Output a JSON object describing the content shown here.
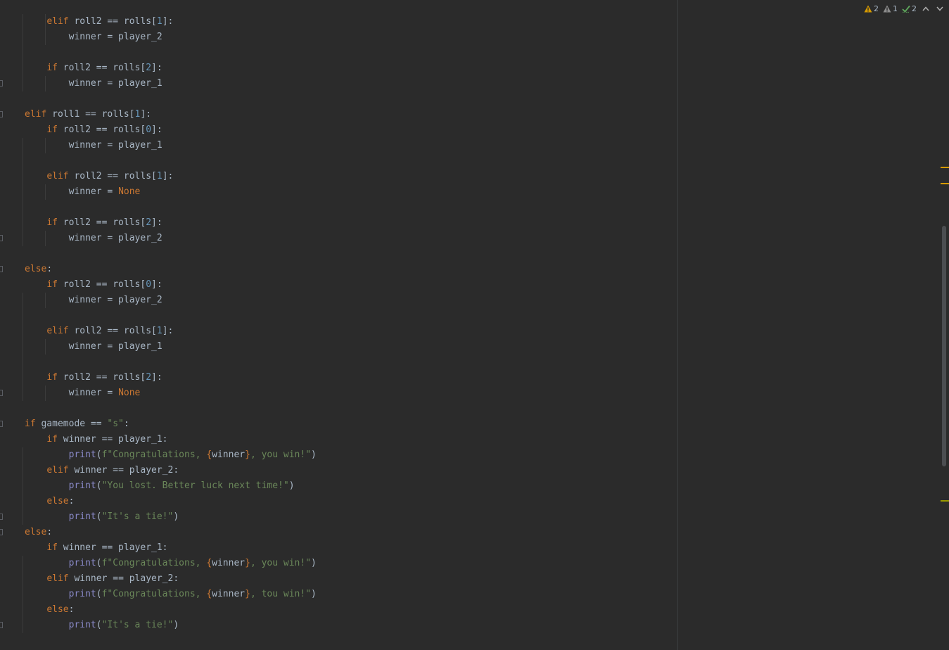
{
  "inspections": {
    "warning_yellow_count": "2",
    "warning_gray_count": "1",
    "typo_count": "2"
  },
  "colors": {
    "background": "#2b2b2b",
    "keyword": "#cc7832",
    "number": "#6897bb",
    "string": "#6a8759",
    "builtin": "#8888c6",
    "identifier": "#a9b7c6",
    "warning_stripe": "#d69a00",
    "weak_stripe": "#999900"
  },
  "code_lines": [
    [
      {
        "t": "    "
      },
      {
        "t": "elif",
        "c": "kw"
      },
      {
        "t": " roll2 == rolls["
      },
      {
        "t": "1",
        "c": "num"
      },
      {
        "t": "]:"
      }
    ],
    [
      {
        "t": "        winner = player_2"
      }
    ],
    [],
    [
      {
        "t": "    "
      },
      {
        "t": "if",
        "c": "kw"
      },
      {
        "t": " roll2 == rolls["
      },
      {
        "t": "2",
        "c": "num"
      },
      {
        "t": "]:"
      }
    ],
    [
      {
        "t": "        winner = player_1"
      }
    ],
    [],
    [
      {
        "t": "elif",
        "c": "kw"
      },
      {
        "t": " roll1 == rolls["
      },
      {
        "t": "1",
        "c": "num"
      },
      {
        "t": "]:"
      }
    ],
    [
      {
        "t": "    "
      },
      {
        "t": "if",
        "c": "kw"
      },
      {
        "t": " roll2 == rolls["
      },
      {
        "t": "0",
        "c": "num"
      },
      {
        "t": "]:"
      }
    ],
    [
      {
        "t": "        winner = player_1"
      }
    ],
    [],
    [
      {
        "t": "    "
      },
      {
        "t": "elif",
        "c": "kw"
      },
      {
        "t": " roll2 == rolls["
      },
      {
        "t": "1",
        "c": "num"
      },
      {
        "t": "]:"
      }
    ],
    [
      {
        "t": "        winner = "
      },
      {
        "t": "None",
        "c": "kw"
      }
    ],
    [],
    [
      {
        "t": "    "
      },
      {
        "t": "if",
        "c": "kw"
      },
      {
        "t": " roll2 == rolls["
      },
      {
        "t": "2",
        "c": "num"
      },
      {
        "t": "]:"
      }
    ],
    [
      {
        "t": "        winner = player_2"
      }
    ],
    [],
    [
      {
        "t": "else",
        "c": "kw"
      },
      {
        "t": ":"
      }
    ],
    [
      {
        "t": "    "
      },
      {
        "t": "if",
        "c": "kw"
      },
      {
        "t": " roll2 == rolls["
      },
      {
        "t": "0",
        "c": "num"
      },
      {
        "t": "]:"
      }
    ],
    [
      {
        "t": "        winner = player_2"
      }
    ],
    [],
    [
      {
        "t": "    "
      },
      {
        "t": "elif",
        "c": "kw"
      },
      {
        "t": " roll2 == rolls["
      },
      {
        "t": "1",
        "c": "num"
      },
      {
        "t": "]:"
      }
    ],
    [
      {
        "t": "        winner = player_1"
      }
    ],
    [],
    [
      {
        "t": "    "
      },
      {
        "t": "if",
        "c": "kw"
      },
      {
        "t": " roll2 == rolls["
      },
      {
        "t": "2",
        "c": "num"
      },
      {
        "t": "]:"
      }
    ],
    [
      {
        "t": "        winner = "
      },
      {
        "t": "None",
        "c": "kw"
      }
    ],
    [],
    [
      {
        "t": "if",
        "c": "kw"
      },
      {
        "t": " gamemode == "
      },
      {
        "t": "\"s\"",
        "c": "str"
      },
      {
        "t": ":"
      }
    ],
    [
      {
        "t": "    "
      },
      {
        "t": "if",
        "c": "kw"
      },
      {
        "t": " winner == player_1:"
      }
    ],
    [
      {
        "t": "        "
      },
      {
        "t": "print",
        "c": "fn"
      },
      {
        "t": "("
      },
      {
        "t": "f\"Congratulations, ",
        "c": "str"
      },
      {
        "t": "{",
        "c": "br"
      },
      {
        "t": "winner"
      },
      {
        "t": "}",
        "c": "br"
      },
      {
        "t": ", you win!\"",
        "c": "str"
      },
      {
        "t": ")"
      }
    ],
    [
      {
        "t": "    "
      },
      {
        "t": "elif",
        "c": "kw"
      },
      {
        "t": " winner == player_2:"
      }
    ],
    [
      {
        "t": "        "
      },
      {
        "t": "print",
        "c": "fn"
      },
      {
        "t": "("
      },
      {
        "t": "\"You lost. Better luck next time!\"",
        "c": "str"
      },
      {
        "t": ")"
      }
    ],
    [
      {
        "t": "    "
      },
      {
        "t": "else",
        "c": "kw"
      },
      {
        "t": ":"
      }
    ],
    [
      {
        "t": "        "
      },
      {
        "t": "print",
        "c": "fn"
      },
      {
        "t": "("
      },
      {
        "t": "\"It's a tie!\"",
        "c": "str"
      },
      {
        "t": ")"
      }
    ],
    [
      {
        "t": "else",
        "c": "kw"
      },
      {
        "t": ":"
      }
    ],
    [
      {
        "t": "    "
      },
      {
        "t": "if",
        "c": "kw"
      },
      {
        "t": " winner == player_1:"
      }
    ],
    [
      {
        "t": "        "
      },
      {
        "t": "print",
        "c": "fn"
      },
      {
        "t": "("
      },
      {
        "t": "f\"Congratulations, ",
        "c": "str"
      },
      {
        "t": "{",
        "c": "br"
      },
      {
        "t": "winner"
      },
      {
        "t": "}",
        "c": "br"
      },
      {
        "t": ", you win!\"",
        "c": "str"
      },
      {
        "t": ")"
      }
    ],
    [
      {
        "t": "    "
      },
      {
        "t": "elif",
        "c": "kw"
      },
      {
        "t": " winner == player_2:"
      }
    ],
    [
      {
        "t": "        "
      },
      {
        "t": "print",
        "c": "fn"
      },
      {
        "t": "("
      },
      {
        "t": "f\"Congratulations, ",
        "c": "str"
      },
      {
        "t": "{",
        "c": "br"
      },
      {
        "t": "winner"
      },
      {
        "t": "}",
        "c": "br"
      },
      {
        "t": ", tou win!\"",
        "c": "str"
      },
      {
        "t": ")"
      }
    ],
    [
      {
        "t": "    "
      },
      {
        "t": "else",
        "c": "kw"
      },
      {
        "t": ":"
      }
    ],
    [
      {
        "t": "        "
      },
      {
        "t": "print",
        "c": "fn"
      },
      {
        "t": "("
      },
      {
        "t": "\"It's a tie!\"",
        "c": "str"
      },
      {
        "t": ")"
      }
    ]
  ]
}
